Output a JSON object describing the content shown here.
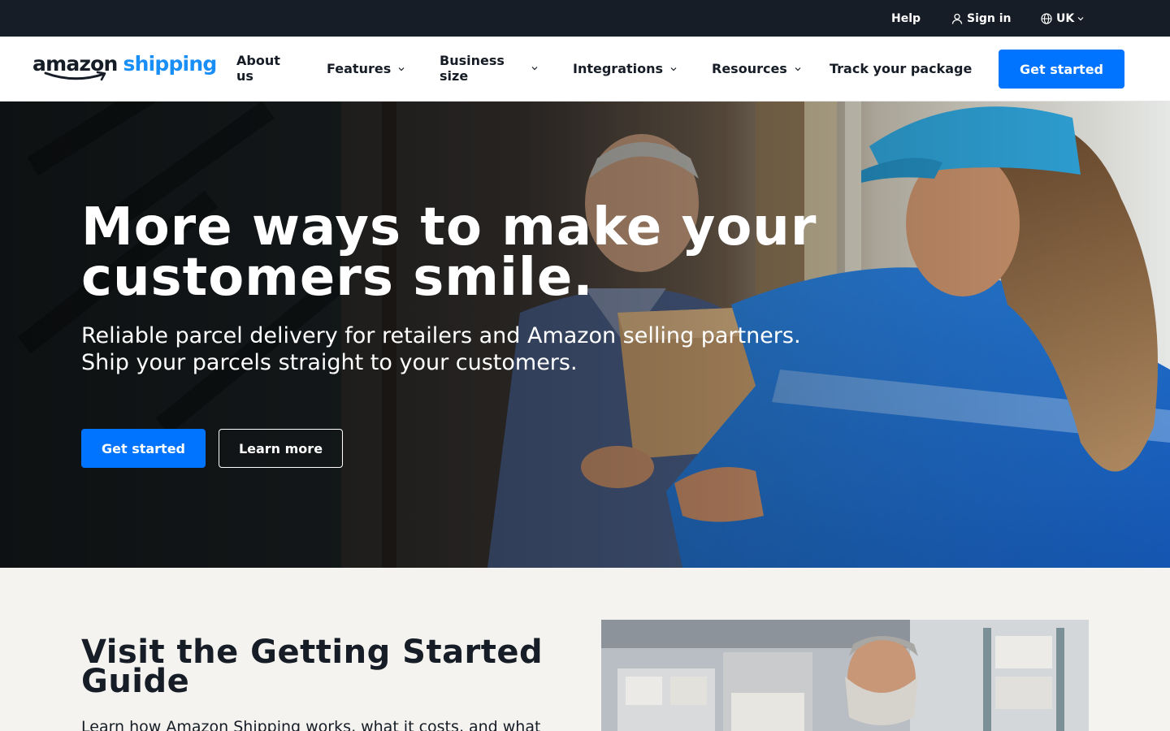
{
  "utility": {
    "help": "Help",
    "sign_in": "Sign in",
    "region": "UK"
  },
  "brand": {
    "name_primary": "amazon",
    "name_secondary": "shipping",
    "accent_color": "#1a8ef7",
    "smile_color": "#161d26"
  },
  "nav": {
    "about": "About us",
    "features": "Features",
    "business_size": "Business size",
    "integrations": "Integrations",
    "resources": "Resources",
    "track": "Track your package",
    "cta": "Get started"
  },
  "hero": {
    "title": "More ways to make your customers smile.",
    "subtitle_line1": "Reliable parcel delivery for retailers and Amazon selling partners.",
    "subtitle_line2": "Ship your parcels straight to your customers.",
    "primary_cta": "Get started",
    "secondary_cta": "Learn more"
  },
  "guide": {
    "title": "Visit the Getting Started Guide",
    "text": "Learn how Amazon Shipping works, what it costs, and what"
  },
  "colors": {
    "primary_button": "#0073ff",
    "dark_bar": "#161d26",
    "section_background": "#f4f3ef",
    "courier_uniform": "#1f74d8"
  },
  "icons": {
    "user": "user-icon",
    "globe": "globe-icon",
    "chevron": "chevron-down-icon"
  }
}
